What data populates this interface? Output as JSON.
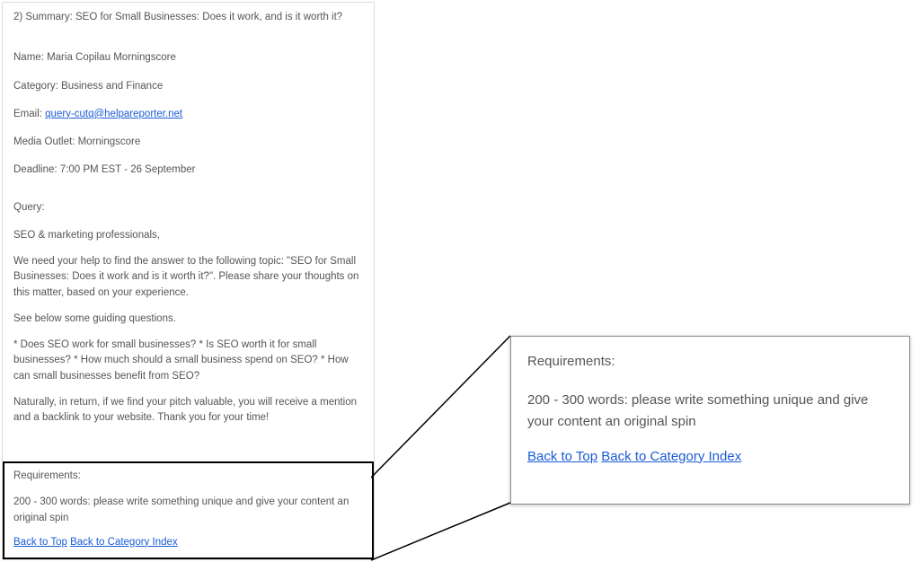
{
  "email": {
    "summary_prefix": "2) Summary: ",
    "summary": "SEO for Small Businesses: Does it work, and is it worth it?",
    "name_label": "Name: ",
    "name": "Maria Copilau Morningscore",
    "category_label": "Category: ",
    "category": "Business and Finance",
    "email_label": "Email: ",
    "email_link": "query-cutq@helpareporter.net",
    "outlet_label": "Media Outlet: ",
    "outlet": "Morningscore",
    "deadline_label": "Deadline: ",
    "deadline": "7:00 PM EST - 26 September",
    "query_label": "Query:",
    "query_p1": "SEO & marketing professionals,",
    "query_p2": "We need your help to find the answer to the following topic: \"SEO for Small Businesses: Does it work and is it worth it?\". Please share your thoughts on this matter, based on your experience.",
    "query_p3": "See below some guiding questions.",
    "query_p4": "* Does SEO work for small businesses? * Is SEO worth it for small businesses? * How much should a small business spend on SEO? * How can small businesses benefit from SEO?",
    "query_p5": "Naturally, in return, if we find your pitch valuable, you will receive a mention and a backlink to your website. Thank you for your time!"
  },
  "requirements": {
    "title": "Requirements:",
    "body": "200 - 300 words: please write something unique and give your content an original spin",
    "link1": "Back to Top",
    "link2": "Back to Category Index"
  },
  "zoom": {
    "title": "Requirements:",
    "body": "200 - 300 words: please write something unique and give your content an original spin",
    "link1": "Back to Top",
    "link2": "Back to Category Index"
  }
}
